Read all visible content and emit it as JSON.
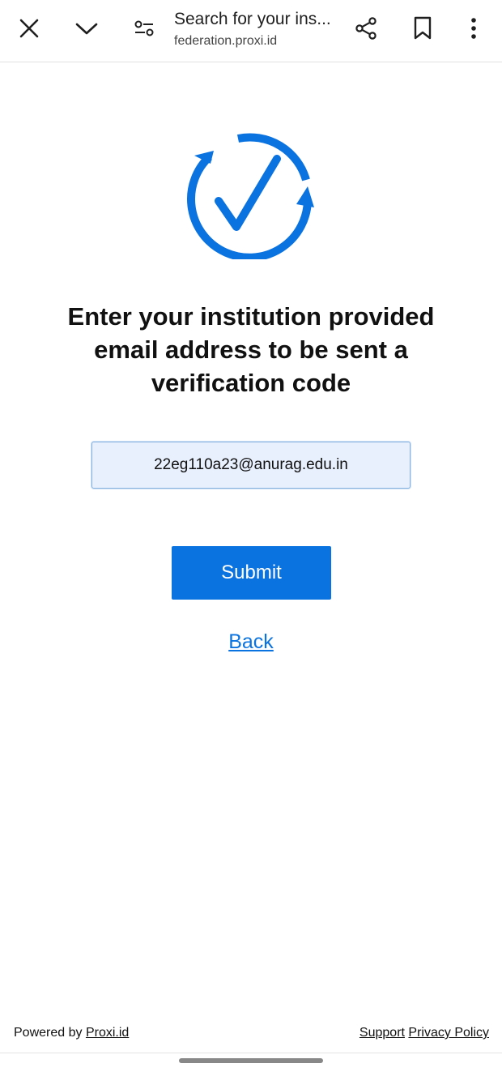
{
  "browser": {
    "title": "Search for your ins...",
    "domain": "federation.proxi.id",
    "icons": {
      "close": "close-icon",
      "minimize": "chevron-down-icon",
      "page_settings": "tune-icon",
      "share": "share-icon",
      "bookmark": "bookmark-icon",
      "more": "more-vert-icon"
    }
  },
  "main": {
    "logo_icon": "verified-check-cycle-icon",
    "heading": "Enter your institution provided email address to be sent a verification code",
    "email_value": "22eg110a23@anurag.edu.in",
    "submit_label": "Submit",
    "back_label": "Back"
  },
  "footer": {
    "powered_prefix": "Powered by ",
    "powered_link": "Proxi.id",
    "support": "Support",
    "privacy": "Privacy Policy"
  },
  "colors": {
    "accent": "#0b73e0",
    "input_background": "#e8f0fe"
  }
}
